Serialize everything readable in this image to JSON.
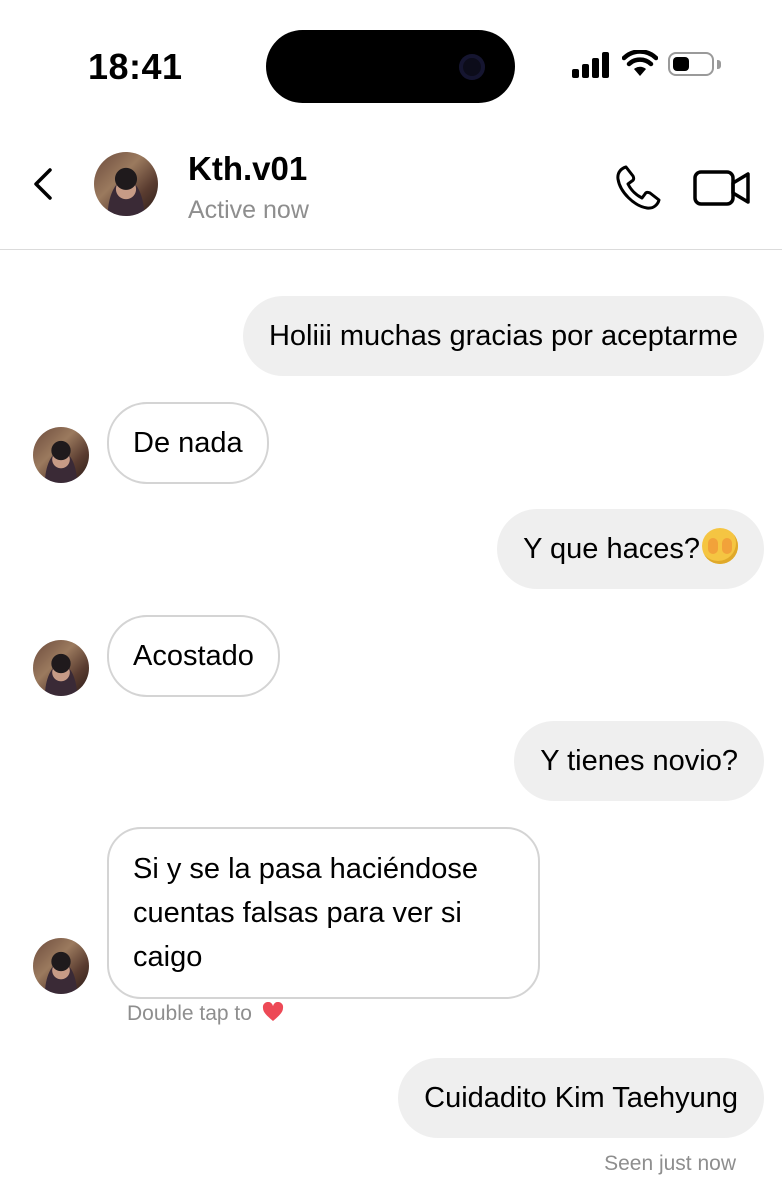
{
  "status_bar": {
    "time": "18:41"
  },
  "header": {
    "name": "Kth.v01",
    "status": "Active now"
  },
  "messages": [
    {
      "side": "sent",
      "text": "Holiii muchas gracias por aceptarme"
    },
    {
      "side": "received",
      "text": "De nada"
    },
    {
      "side": "sent",
      "text": "Y que haces?",
      "emoji": "face-with-open-eyes-and-hand-over-mouth"
    },
    {
      "side": "received",
      "text": "Acostado"
    },
    {
      "side": "sent",
      "text": "Y tienes novio?"
    },
    {
      "side": "received",
      "text": "Si y se la pasa haciéndose cuentas falsas para ver si caigo"
    },
    {
      "side": "sent",
      "text": "Cuidadito Kim Taehyung"
    }
  ],
  "hint": {
    "text": "Double tap to",
    "icon": "heart-icon",
    "color": "#ed4956"
  },
  "seen": "Seen just now",
  "colors": {
    "sent_bubble": "#efefef",
    "received_border": "#d4d4d4",
    "muted_text": "#8e8e8e"
  }
}
